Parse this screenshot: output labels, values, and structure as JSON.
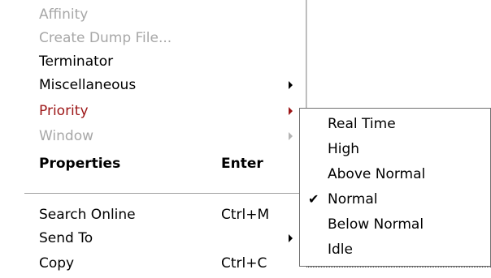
{
  "menu": {
    "items": [
      {
        "label": "Affinity",
        "shortcut": "",
        "submenu": false,
        "state": "disabled"
      },
      {
        "label": "Create Dump File...",
        "shortcut": "",
        "submenu": false,
        "state": "disabled"
      },
      {
        "label": "Terminator",
        "shortcut": "",
        "submenu": false,
        "state": "normal"
      },
      {
        "label": "Miscellaneous",
        "shortcut": "",
        "submenu": true,
        "state": "normal"
      },
      {
        "label": "Priority",
        "shortcut": "",
        "submenu": true,
        "state": "active"
      },
      {
        "label": "Window",
        "shortcut": "",
        "submenu": true,
        "state": "disabled"
      },
      {
        "label": "Properties",
        "shortcut": "Enter",
        "submenu": false,
        "state": "bold"
      },
      {
        "label": "Search Online",
        "shortcut": "Ctrl+M",
        "submenu": false,
        "state": "normal"
      },
      {
        "label": "Send To",
        "shortcut": "",
        "submenu": true,
        "state": "normal"
      },
      {
        "label": "Copy",
        "shortcut": "Ctrl+C",
        "submenu": false,
        "state": "normal"
      }
    ]
  },
  "priority_submenu": {
    "items": [
      {
        "label": "Real Time",
        "checked": false
      },
      {
        "label": "High",
        "checked": false
      },
      {
        "label": "Above Normal",
        "checked": false
      },
      {
        "label": "Normal",
        "checked": true
      },
      {
        "label": "Below Normal",
        "checked": false
      },
      {
        "label": "Idle",
        "checked": false
      }
    ],
    "check_glyph": "✔"
  },
  "colors": {
    "active_text": "#9c1516",
    "disabled_text": "#a7a7a7",
    "border": "#6f6f6f"
  }
}
